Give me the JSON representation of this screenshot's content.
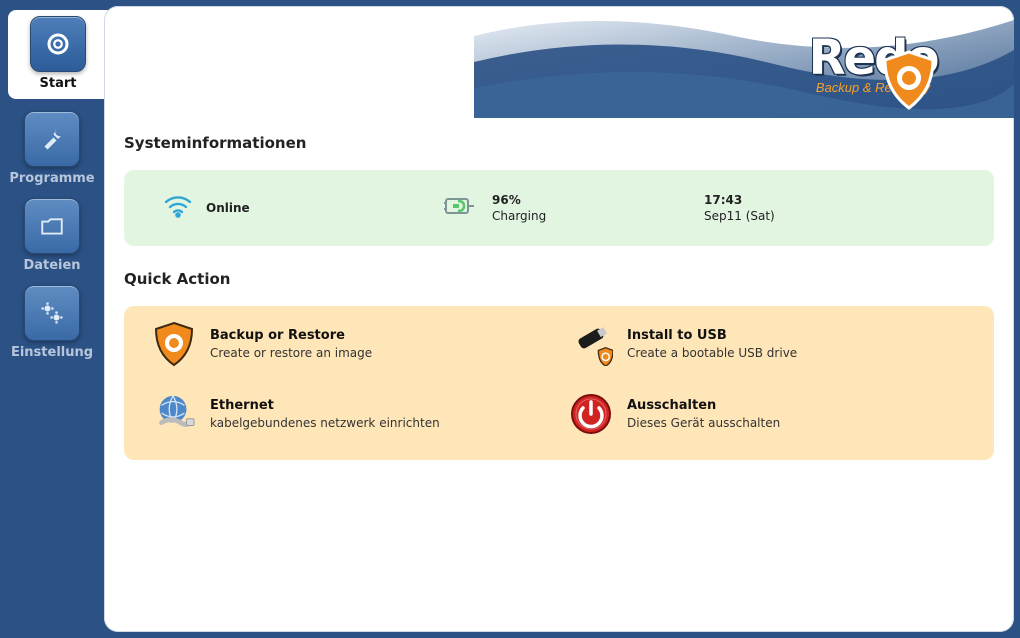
{
  "sidebar": {
    "items": [
      {
        "label": "Start"
      },
      {
        "label": "Programme"
      },
      {
        "label": "Dateien"
      },
      {
        "label": "Einstellung"
      }
    ]
  },
  "branding": {
    "name": "Redo",
    "tagline": "Backup & Recovery"
  },
  "sections": {
    "sysinfo_title": "Systeminformationen",
    "quickaction_title": "Quick Action"
  },
  "sysinfo": {
    "network_status": "Online",
    "battery_pct": "96%",
    "battery_state": "Charging",
    "clock_time": "17:43",
    "clock_date": "Sep11 (Sat)"
  },
  "quick_actions": {
    "backup": {
      "title": "Backup or Restore",
      "sub": "Create or restore an image"
    },
    "usb": {
      "title": "Install to USB",
      "sub": "Create a bootable USB drive"
    },
    "ethernet": {
      "title": "Ethernet",
      "sub": "kabelgebundenes netzwerk einrichten"
    },
    "power": {
      "title": "Ausschalten",
      "sub": "Dieses Gerät ausschalten"
    }
  }
}
